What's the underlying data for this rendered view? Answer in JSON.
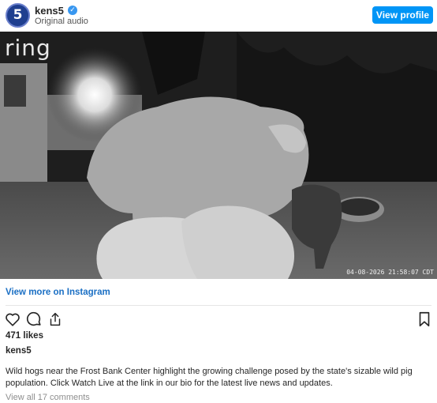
{
  "header": {
    "avatar_text": "5",
    "username": "kens5",
    "verified_mark": "✓",
    "subtitle": "Original audio",
    "view_profile_label": "View profile"
  },
  "media": {
    "logo_text": "ring",
    "timestamp": "04-08-2026 21:58:07 CDT"
  },
  "post": {
    "view_more_label": "View more on Instagram",
    "likes": "471 likes",
    "owner": "kens5",
    "caption": "Wild hogs near the Frost Bank Center highlight the growing challenge posed by the state's sizable wild pig population. Click Watch Live at the link in our bio for the latest live news and updates.",
    "comments_link": "View all 17 comments"
  },
  "icons": {
    "like": "heart-icon",
    "comment": "comment-icon",
    "share": "share-icon",
    "save": "bookmark-icon"
  },
  "colors": {
    "accent": "#0095f6",
    "link": "#1a6fc4"
  }
}
